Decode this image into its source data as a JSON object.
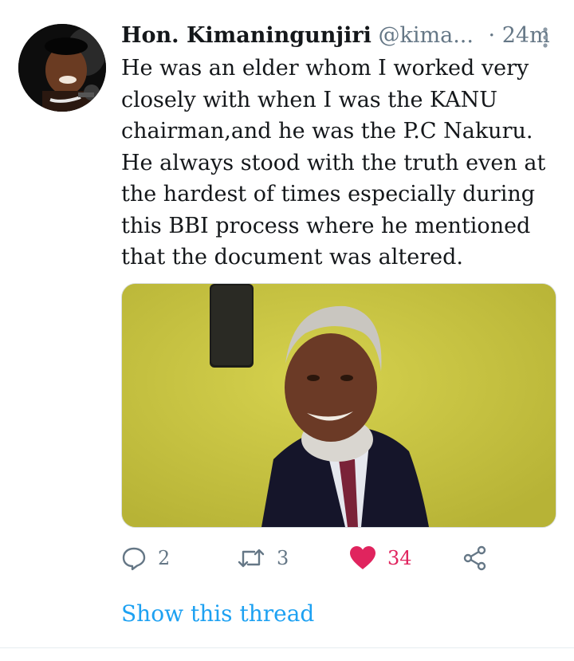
{
  "author": {
    "name": "Hon. Kimaningunjiri",
    "handle": "@kima...",
    "separator": "·",
    "time": "24m"
  },
  "tweet": {
    "lines": [
      "He was an elder whom I worked very",
      "closely with when I was the KANU",
      "chairman,and he was the P.C Nakuru.",
      "He always stood with the truth even at",
      "the hardest of times especially during",
      "this BBI process where he mentioned",
      "that the document was altered."
    ]
  },
  "actions": {
    "replies": "2",
    "retweets": "3",
    "likes": "34",
    "liked": true
  },
  "links": {
    "show_thread": "Show this thread"
  },
  "icons": {
    "more": "more-vertical-icon",
    "reply": "reply-icon",
    "retweet": "retweet-icon",
    "like": "heart-icon",
    "share": "share-icon"
  },
  "colors": {
    "link": "#1da1f2",
    "like": "#e0245e",
    "muted": "#657786",
    "text": "#14171a"
  }
}
